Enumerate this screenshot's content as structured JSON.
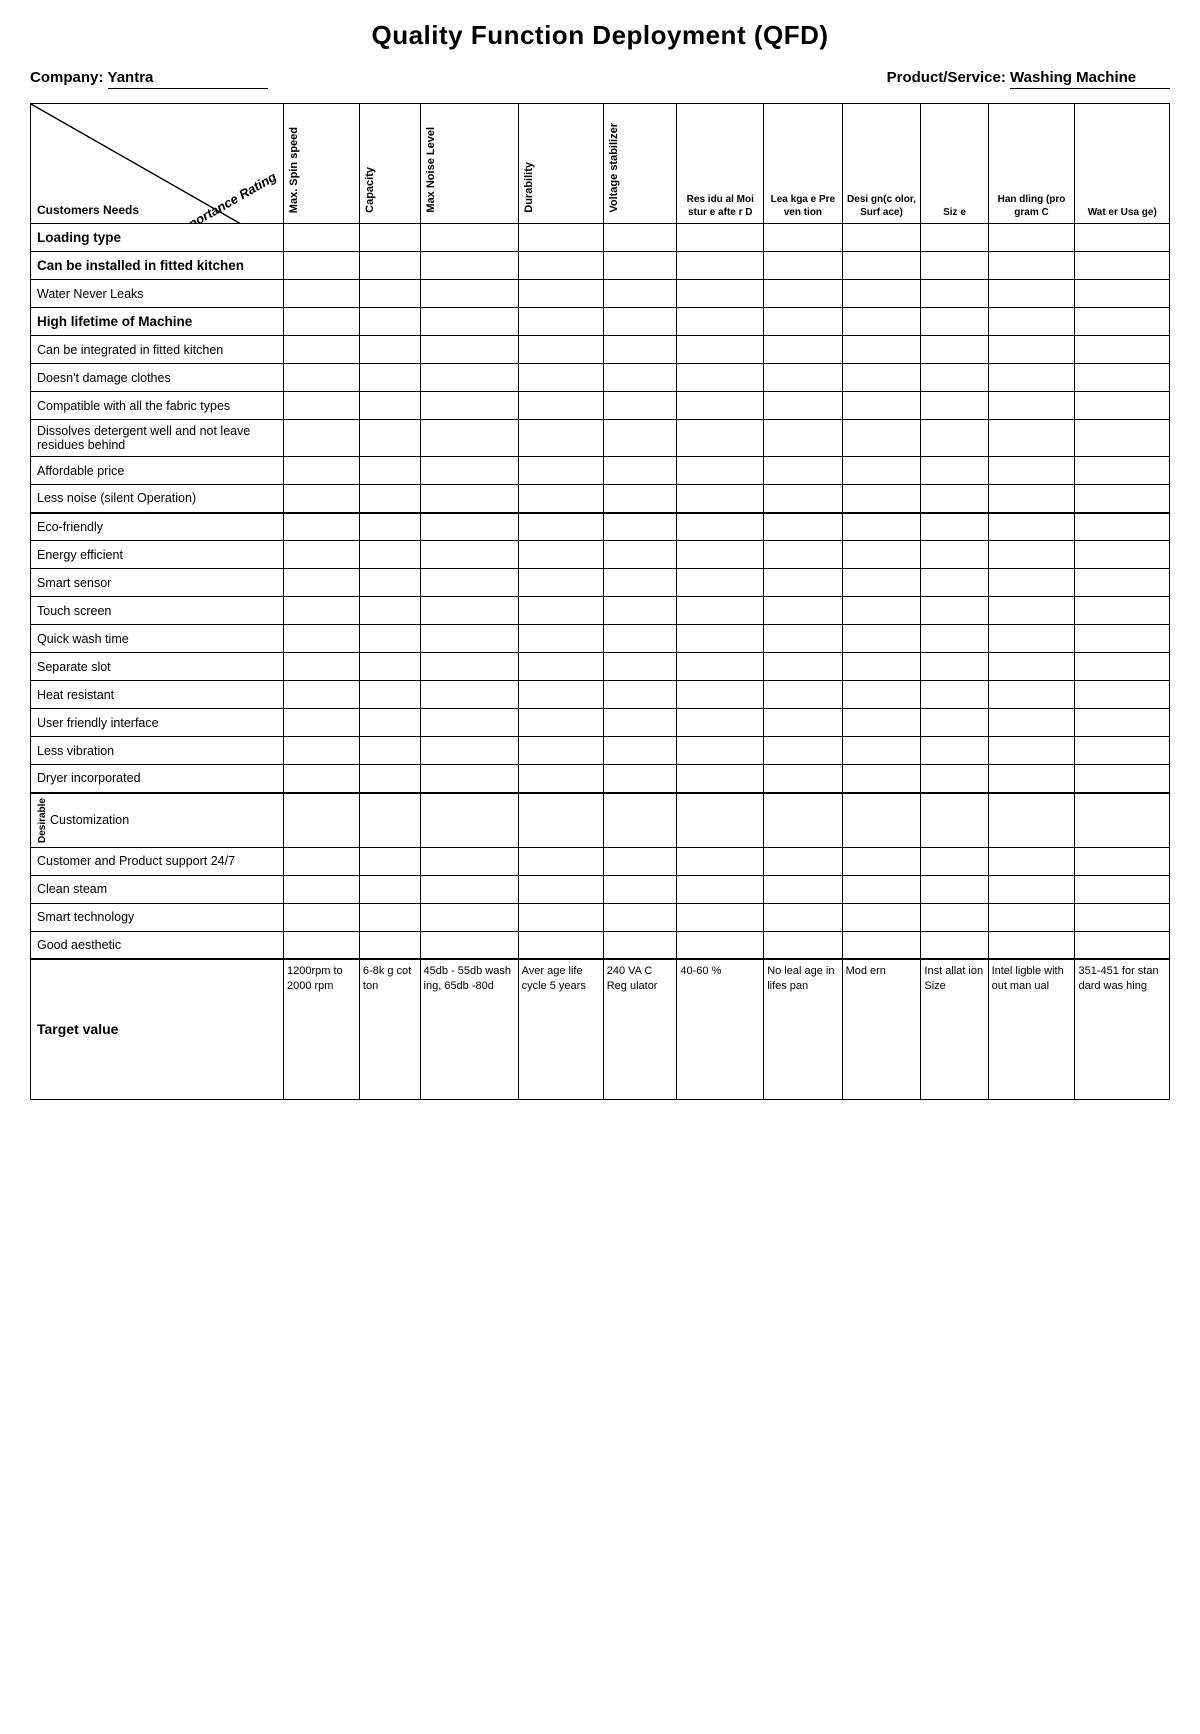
{
  "title": "Quality Function Deployment (QFD)",
  "company_label": "Company:",
  "company_name": "Yantra",
  "product_label": "Product/Service:",
  "product_name": "Washing Machine",
  "importance_rating": "Importance Rating",
  "customers_needs": "Customers Needs",
  "columns": [
    {
      "id": "spin",
      "label": "Max. Spin speed"
    },
    {
      "id": "capacity",
      "label": "Capacity"
    },
    {
      "id": "noise",
      "label": "Max Noise Level"
    },
    {
      "id": "durability",
      "label": "Durability"
    },
    {
      "id": "voltage",
      "label": "Voltage stabilizer"
    },
    {
      "id": "residual",
      "label": "Residual Moisture after D"
    },
    {
      "id": "leakage",
      "label": "Leakage Pre vention"
    },
    {
      "id": "design",
      "label": "Design(color, Surface)"
    },
    {
      "id": "size",
      "label": "Size e"
    },
    {
      "id": "handling",
      "label": "Handling (program C"
    },
    {
      "id": "water",
      "label": "Water Usage)"
    }
  ],
  "rows": [
    {
      "id": 1,
      "label": "Loading type",
      "bold": true
    },
    {
      "id": 2,
      "label": "Can be installed in fitted kitchen",
      "bold": true
    },
    {
      "id": 3,
      "label": "Water Never Leaks",
      "bold": false
    },
    {
      "id": 4,
      "label": "High lifetime of Machine",
      "bold": true
    },
    {
      "id": 5,
      "label": "Can be integrated in fitted kitchen",
      "bold": false
    },
    {
      "id": 6,
      "label": "Doesn't damage clothes",
      "bold": false
    },
    {
      "id": 7,
      "label": "Compatible with all the fabric types",
      "bold": false
    },
    {
      "id": 8,
      "label": "Dissolves detergent well and not leave residues behind",
      "bold": false
    },
    {
      "id": 9,
      "label": "Affordable price",
      "bold": false
    },
    {
      "id": 10,
      "label": "Less noise (silent Operation)",
      "bold": false
    },
    {
      "id": 11,
      "label": "Eco-friendly",
      "bold": false
    },
    {
      "id": 12,
      "label": "Energy efficient",
      "bold": false
    },
    {
      "id": 13,
      "label": "Smart sensor",
      "bold": false
    },
    {
      "id": 14,
      "label": "Touch screen",
      "bold": false
    },
    {
      "id": 15,
      "label": "Quick wash time",
      "bold": false
    },
    {
      "id": 16,
      "label": "Separate slot",
      "bold": false
    },
    {
      "id": 17,
      "label": "Heat resistant",
      "bold": false
    },
    {
      "id": 18,
      "label": "User friendly interface",
      "bold": false
    },
    {
      "id": 19,
      "label": "Less vibration",
      "bold": false
    },
    {
      "id": 20,
      "label": "Dryer incorporated",
      "bold": false
    },
    {
      "id": 21,
      "label": "Customization",
      "bold": false
    },
    {
      "id": 22,
      "label": "Customer and Product support 24/7",
      "bold": false
    },
    {
      "id": 23,
      "label": "Clean steam",
      "bold": false
    },
    {
      "id": 24,
      "label": "Smart technology",
      "bold": false
    },
    {
      "id": 25,
      "label": "Good aesthetic",
      "bold": false
    }
  ],
  "target_label": "Target value",
  "target_values": [
    "1200rpm to 2000 rpm",
    "6-8k g cot ton",
    "45db - 55db wash ing, 65db -80d",
    "Aver age life cycle 5 years",
    "240 VA C Reg ulator",
    "40-60 %",
    "No leal age in lifes pan",
    "Mod ern",
    "Inst allat ion Size",
    "Intel ligble with out man ual",
    "351-451 for stan dard was hing"
  ]
}
